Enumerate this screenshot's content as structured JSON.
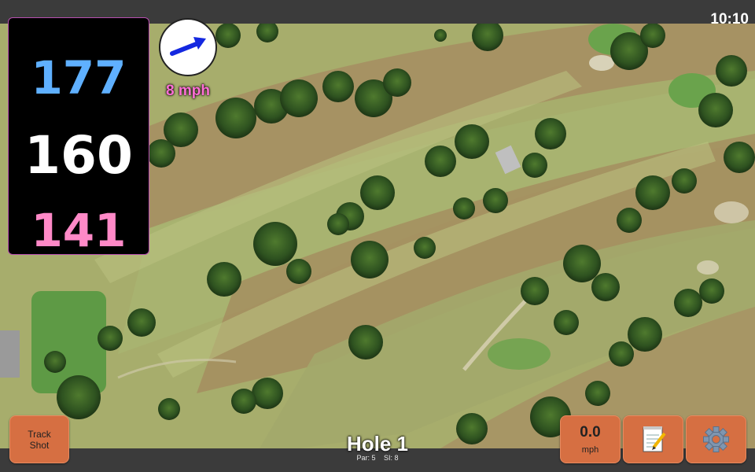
{
  "status_bar": {
    "time": "10:10"
  },
  "distances": {
    "back": "177",
    "middle": "160",
    "front": "141"
  },
  "wind": {
    "speed": "8 mph",
    "direction_icon": "wind-arrow-icon"
  },
  "hole": {
    "title": "Hole 1",
    "par": "Par: 5",
    "stroke_index": "SI: 8"
  },
  "buttons": {
    "track_shot_line1": "Track",
    "track_shot_line2": "Shot",
    "speed_value": "0.0",
    "speed_unit": "mph",
    "notes_icon": "notepad-icon",
    "settings_icon": "gear-icon"
  },
  "colors": {
    "back_distance": "#5fb0ff",
    "middle_distance": "#ffffff",
    "front_distance": "#ff89c7",
    "wind_text": "#ff6fd6",
    "button_bg": "#d66f42",
    "accent_border": "#b84fb0"
  }
}
